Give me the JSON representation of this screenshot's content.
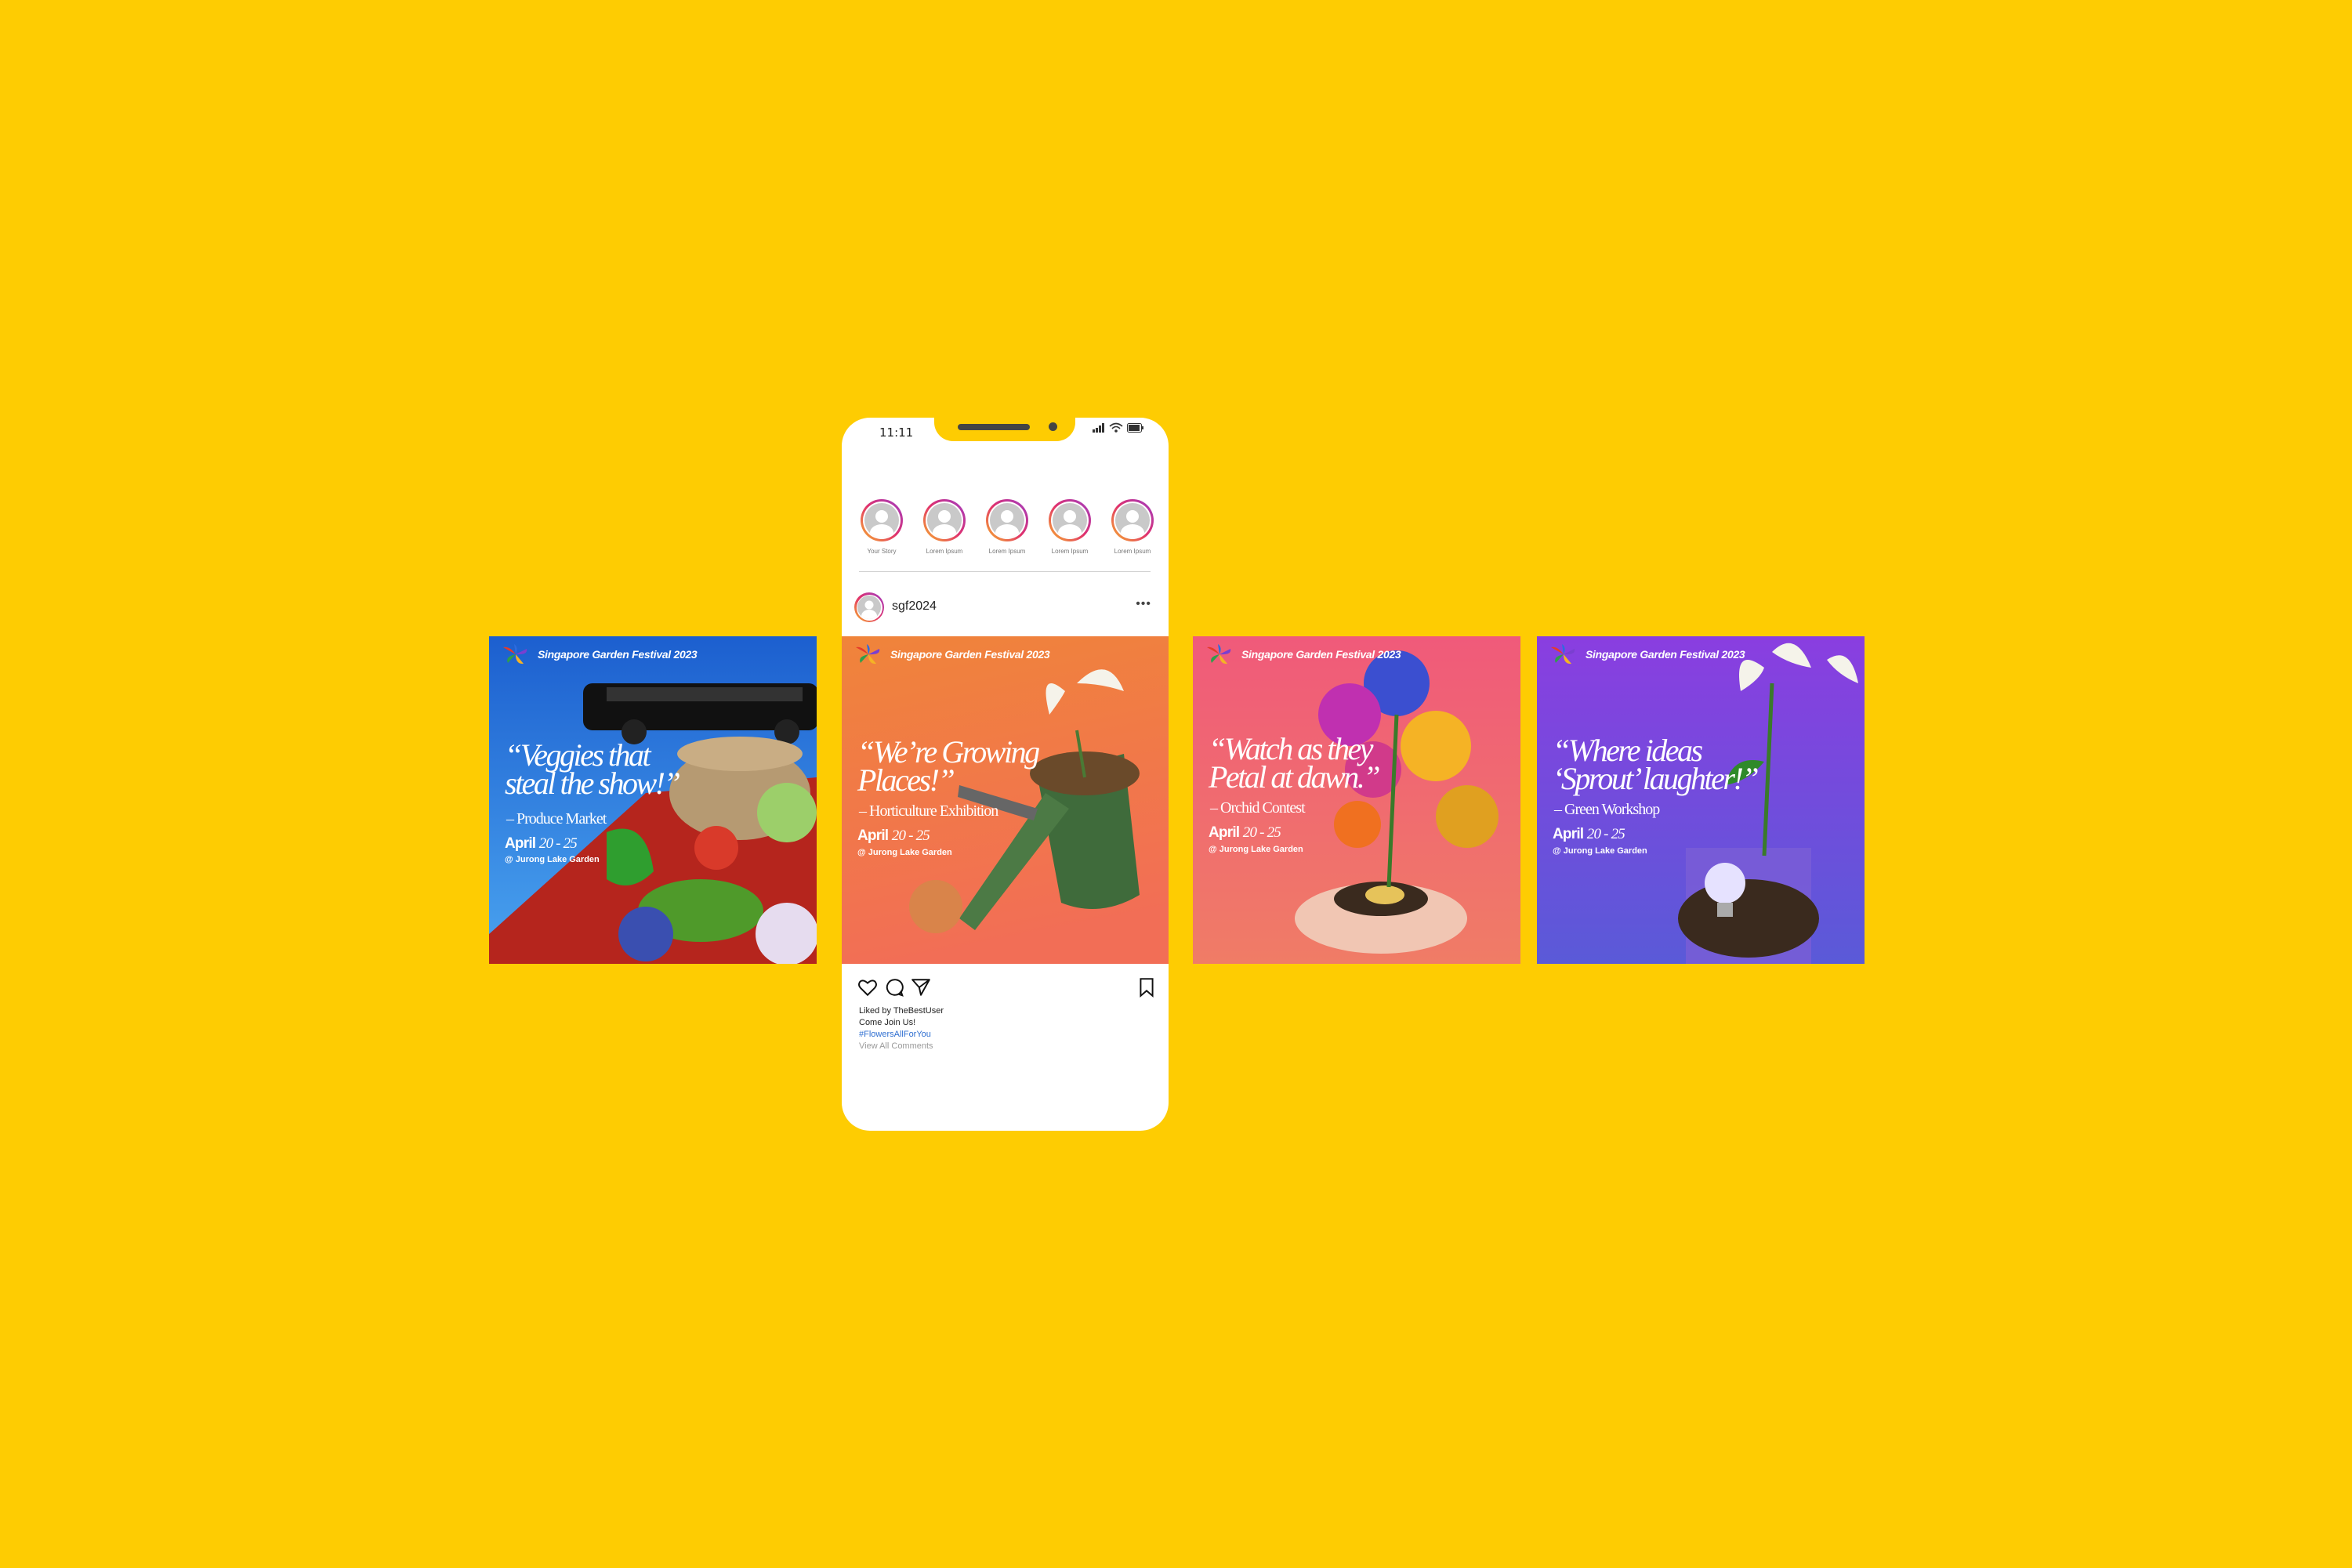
{
  "festival": {
    "name": "Singapore Garden Festival 2023"
  },
  "posts": [
    {
      "headline": "“Veggies that steal the show!”",
      "headline_lines": [
        "“Veggies that",
        "steal the show!”"
      ],
      "subtitle": "– Produce Market",
      "date_prefix": "April",
      "date_range": "20 - 25",
      "venue": "@ Jurong Lake Garden",
      "background": [
        "#1c5fcf",
        "#4aa4f0"
      ],
      "accent": "#b5251d"
    },
    {
      "headline": "“We’re Growing Places!”",
      "headline_lines": [
        "“We’re Growing",
        "Places!”"
      ],
      "subtitle": "– Horticulture Exhibition",
      "date_prefix": "April",
      "date_range": "20 - 25",
      "venue": "@ Jurong Lake Garden",
      "background": [
        "#f0843a",
        "#f26e56"
      ]
    },
    {
      "headline": "“Watch as they Petal at dawn.”",
      "headline_lines": [
        "“Watch as they",
        "Petal at dawn.”"
      ],
      "subtitle": "– Orchid Contest",
      "date_prefix": "April",
      "date_range": "20 - 25",
      "venue": "@ Jurong Lake Garden",
      "background": [
        "#f05a7a",
        "#f07c66"
      ]
    },
    {
      "headline": "“Where ideas ‘Sprout’ laughter!”",
      "headline_lines": [
        "“Where ideas",
        "‘Sprout’ laughter!”"
      ],
      "subtitle": "– Green Workshop",
      "date_prefix": "April",
      "date_range": "20 - 25",
      "venue": "@ Jurong Lake Garden",
      "background": [
        "#8a3ee0",
        "#5a5ad8"
      ]
    }
  ],
  "phone": {
    "time": "11:11",
    "stories": [
      {
        "label": "Your Story"
      },
      {
        "label": "Lorem Ipsum"
      },
      {
        "label": "Lorem Ipsum"
      },
      {
        "label": "Lorem Ipsum"
      },
      {
        "label": "Lorem Ipsum"
      }
    ],
    "username": "sgf2024",
    "more_label": "•••",
    "liked_by": "Liked by TheBestUser",
    "caption": "Come Join Us!",
    "hashtag": "#FlowersAllForYou",
    "view_comments": "View All Comments"
  },
  "colors": {
    "page_background": "#FECC02",
    "phone": "#ffffff",
    "hashtag": "#2f6fd1"
  },
  "icons": [
    "signal-icon",
    "wifi-icon",
    "battery-icon",
    "heart-icon",
    "comment-icon",
    "share-icon",
    "bookmark-icon",
    "more-icon"
  ]
}
